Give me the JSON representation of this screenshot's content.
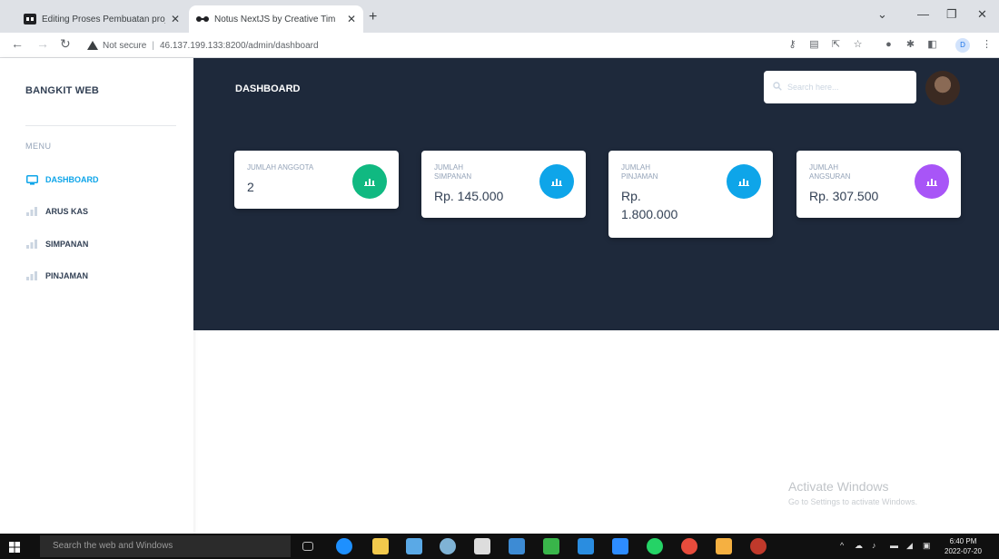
{
  "browser": {
    "tabs": [
      {
        "title": "Editing Proses Pembuatan proje",
        "active": false
      },
      {
        "title": "Notus NextJS by Creative Tim",
        "active": true
      }
    ],
    "security": "Not secure",
    "url": "46.137.199.133:8200/admin/dashboard",
    "profile_initial": "D"
  },
  "sidebar": {
    "brand": "BANGKIT WEB",
    "menu_heading": "MENU",
    "items": [
      {
        "label": "DASHBOARD",
        "active": true
      },
      {
        "label": "ARUS KAS",
        "active": false
      },
      {
        "label": "SIMPANAN",
        "active": false
      },
      {
        "label": "PINJAMAN",
        "active": false
      }
    ]
  },
  "header": {
    "title": "DASHBOARD",
    "search_placeholder": "Search here..."
  },
  "cards": [
    {
      "label": "JUMLAH ANGGOTA",
      "value": "2",
      "color": "#10b981"
    },
    {
      "label": "JUMLAH SIMPANAN",
      "value": "Rp. 145.000",
      "color": "#0ea5e9"
    },
    {
      "label": "JUMLAH PINJAMAN",
      "value": "Rp. 1.800.000",
      "color": "#0ea5e9"
    },
    {
      "label": "JUMLAH ANGSURAN",
      "value": "Rp. 307.500",
      "color": "#a855f7"
    }
  ],
  "watermark": {
    "line1": "Activate Windows",
    "line2": "Go to Settings to activate Windows."
  },
  "taskbar": {
    "search_placeholder": "Search the web and Windows",
    "time": "6:40 PM",
    "date": "2022-07-20"
  },
  "colors": {
    "hero": "#1e293b",
    "accent": "#0ea5e9"
  }
}
